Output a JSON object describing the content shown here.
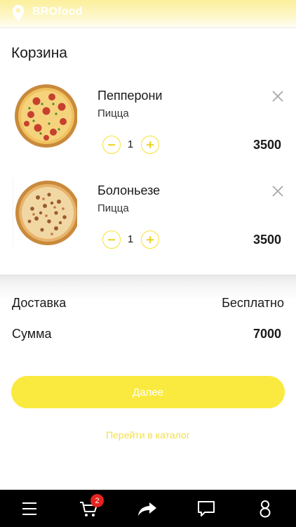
{
  "header": {
    "brand": "BROfood",
    "pin_icon": "location-pin-icon"
  },
  "cart": {
    "title": "Корзина",
    "items": [
      {
        "name": "Пепперони",
        "category": "Пицца",
        "quantity": "1",
        "price": "3500",
        "image": "pepperoni-pizza"
      },
      {
        "name": "Болоньезе",
        "category": "Пицца",
        "quantity": "1",
        "price": "3500",
        "image": "bolognese-pizza"
      }
    ]
  },
  "summary": {
    "delivery_label": "Доставка",
    "delivery_value": "Бесплатно",
    "sum_label": "Сумма",
    "sum_value": "7000"
  },
  "actions": {
    "next_label": "Далее",
    "catalog_link": "Перейти в каталог"
  },
  "tabbar": {
    "items": [
      "menu-icon",
      "cart-icon",
      "share-icon",
      "chat-icon",
      "profile-icon"
    ],
    "cart_badge": "2"
  },
  "colors": {
    "accent": "#faea3f",
    "badge": "#e52320",
    "tabbar": "#000000"
  }
}
